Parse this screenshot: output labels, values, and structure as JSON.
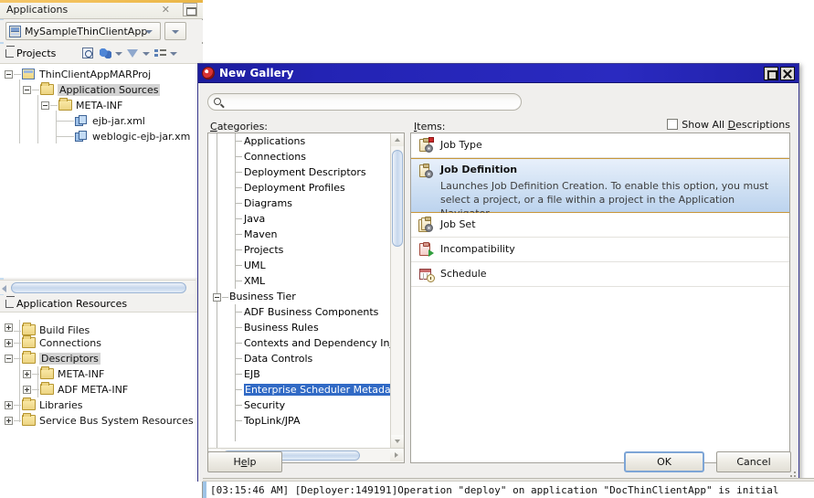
{
  "ide": {
    "applications_panel": {
      "title": "Applications",
      "close_icon": "close-icon",
      "minimize_icon": "minimize-icon",
      "app_selector": {
        "value": "MySampleThinClientApp",
        "icon": "application-icon",
        "dropdown_icon": "chevron-down-icon",
        "side_dropdown_icon": "chevron-down-icon"
      },
      "projects_toolbar": {
        "label": "Projects",
        "collapse_icon": "collapse-icon",
        "buttons": [
          {
            "name": "search-projects-icon",
            "icon": "magnifier-icon"
          },
          {
            "name": "refresh-icon",
            "icon": "refresh-icon"
          },
          {
            "name": "filter-icon",
            "icon": "funnel-icon"
          },
          {
            "name": "group-by-icon",
            "icon": "group-icon"
          }
        ]
      },
      "project_tree": [
        {
          "label": "ThinClientAppMARProj",
          "icon": "project-icon",
          "indent": 0,
          "expander": "minus",
          "selected": false
        },
        {
          "label": "Application Sources",
          "icon": "folder-icon",
          "indent": 1,
          "expander": "minus",
          "selected": true
        },
        {
          "label": "META-INF",
          "icon": "folder-icon",
          "indent": 2,
          "expander": "minus",
          "selected": false
        },
        {
          "label": "ejb-jar.xml",
          "icon": "xml-file-icon",
          "indent": 3,
          "expander": "none",
          "selected": false
        },
        {
          "label": "weblogic-ejb-jar.xm",
          "icon": "xml-file-icon",
          "indent": 3,
          "expander": "none",
          "selected": false
        }
      ],
      "resources_header": {
        "label": "Application Resources",
        "collapse_icon": "collapse-icon"
      },
      "resources_tree": [
        {
          "label": "Build Files",
          "icon": "folder-icon",
          "indent": 0,
          "expander": "plus",
          "selected": false
        },
        {
          "label": "Connections",
          "icon": "folder-icon",
          "indent": 0,
          "expander": "plus",
          "selected": false
        },
        {
          "label": "Descriptors",
          "icon": "folder-icon",
          "indent": 0,
          "expander": "minus",
          "selected": true
        },
        {
          "label": "META-INF",
          "icon": "folder-icon",
          "indent": 1,
          "expander": "plus",
          "selected": false
        },
        {
          "label": "ADF META-INF",
          "icon": "folder-icon",
          "indent": 1,
          "expander": "plus",
          "selected": false
        },
        {
          "label": "Libraries",
          "icon": "folder-icon",
          "indent": 0,
          "expander": "plus",
          "selected": false
        },
        {
          "label": "Service Bus System Resources",
          "icon": "folder-icon",
          "indent": 0,
          "expander": "plus",
          "selected": false
        }
      ]
    },
    "log_line": "[03:15:46 AM] [Deployer:149191]Operation \"deploy\" on application \"DocThinClientApp\" is initial"
  },
  "dialog": {
    "title": "New Gallery",
    "title_icon": "oracle-logo-icon",
    "maximize_icon": "maximize-icon",
    "close_icon": "close-icon",
    "search": {
      "value": "",
      "placeholder": "",
      "icon": "search-icon"
    },
    "categories_label_prefix": "C",
    "categories_label_rest": "ategories:",
    "items_label_prefix": "I",
    "items_label_rest": "tems:",
    "show_all_descriptions": {
      "label_pre": "Show All ",
      "label_underlined": "D",
      "label_post": "escriptions",
      "checked": false
    },
    "categories": [
      {
        "label": "Applications",
        "indent": 1,
        "expander": "none",
        "selected": false
      },
      {
        "label": "Connections",
        "indent": 1,
        "expander": "none",
        "selected": false
      },
      {
        "label": "Deployment Descriptors",
        "indent": 1,
        "expander": "none",
        "selected": false
      },
      {
        "label": "Deployment Profiles",
        "indent": 1,
        "expander": "none",
        "selected": false
      },
      {
        "label": "Diagrams",
        "indent": 1,
        "expander": "none",
        "selected": false
      },
      {
        "label": "Java",
        "indent": 1,
        "expander": "none",
        "selected": false
      },
      {
        "label": "Maven",
        "indent": 1,
        "expander": "none",
        "selected": false
      },
      {
        "label": "Projects",
        "indent": 1,
        "expander": "none",
        "selected": false
      },
      {
        "label": "UML",
        "indent": 1,
        "expander": "none",
        "selected": false
      },
      {
        "label": "XML",
        "indent": 1,
        "expander": "none",
        "selected": false
      },
      {
        "label": "Business Tier",
        "indent": 0,
        "expander": "minus",
        "selected": false
      },
      {
        "label": "ADF Business Components",
        "indent": 1,
        "expander": "none",
        "selected": false
      },
      {
        "label": "Business Rules",
        "indent": 1,
        "expander": "none",
        "selected": false
      },
      {
        "label": "Contexts and Dependency Inj",
        "indent": 1,
        "expander": "none",
        "selected": false
      },
      {
        "label": "Data Controls",
        "indent": 1,
        "expander": "none",
        "selected": false
      },
      {
        "label": "EJB",
        "indent": 1,
        "expander": "none",
        "selected": false
      },
      {
        "label": "Enterprise Scheduler Metadat",
        "indent": 1,
        "expander": "none",
        "selected": true
      },
      {
        "label": "Security",
        "indent": 1,
        "expander": "none",
        "selected": false
      },
      {
        "label": "TopLink/JPA",
        "indent": 1,
        "expander": "none",
        "selected": false
      }
    ],
    "items": [
      {
        "title": "Job Type",
        "icon": "job-type-icon",
        "description": "",
        "selected": false
      },
      {
        "title": "Job Definition",
        "icon": "job-definition-icon",
        "description": "Launches Job Definition Creation. To enable this option, you must select a project, or a file within a project in the Application Navigator.",
        "selected": true
      },
      {
        "title": "Job Set",
        "icon": "job-set-icon",
        "description": "",
        "selected": false
      },
      {
        "title": "Incompatibility",
        "icon": "incompatibility-icon",
        "description": "",
        "selected": false
      },
      {
        "title": "Schedule",
        "icon": "schedule-icon",
        "description": "",
        "selected": false
      }
    ],
    "buttons": {
      "help_pre": "H",
      "help_underlined": "e",
      "help_post": "lp",
      "ok": "OK",
      "cancel": "Cancel"
    }
  },
  "colors": {
    "dialog_titlebar": "#2323b4",
    "selection_blue": "#316ac5",
    "item_selected_border": "#c8973a",
    "accent_orange": "#f0bd54",
    "tree_selection_gray": "#d3d3d3"
  }
}
